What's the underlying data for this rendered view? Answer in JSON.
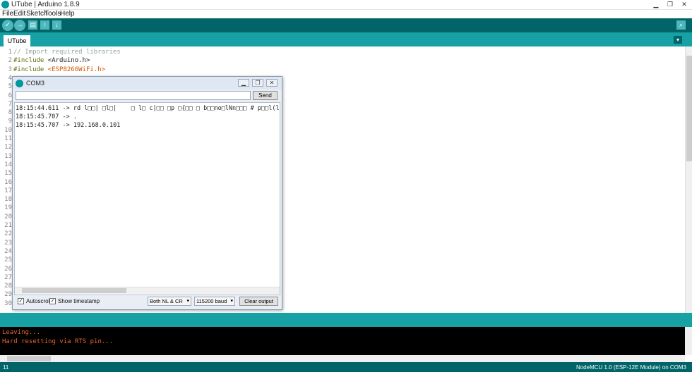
{
  "window": {
    "title": "UTube | Arduino 1.8.9",
    "minimize": "▁",
    "maximize": "❐",
    "close": "✕"
  },
  "menu": [
    "File",
    "Edit",
    "Sketch",
    "Tools",
    "Help"
  ],
  "toolbar": {
    "verify_glyph": "✓",
    "upload_glyph": "→",
    "new_glyph": "▤",
    "open_glyph": "↑",
    "save_glyph": "↓",
    "serial_glyph": "⌕"
  },
  "tab": {
    "label": "UTube",
    "menu_glyph": "▾"
  },
  "editor": {
    "line_numbers": [
      "1",
      "2",
      "3",
      "4",
      "5",
      "6",
      "7",
      "8",
      "9",
      "10",
      "11",
      "12",
      "13",
      "14",
      "15",
      "16",
      "17",
      "18",
      "19",
      "20",
      "21",
      "22",
      "23",
      "24",
      "25",
      "26",
      "27",
      "28",
      "29",
      "30"
    ],
    "line1": "// Import required libraries",
    "line2_kw": "#include",
    "line2_inc": "<Arduino.h>",
    "line3_kw": "#include",
    "line3_inc": "<ESP8266WiFi.h>"
  },
  "console": {
    "lines": [
      "Leaving...",
      "Hard resetting via RTS pin..."
    ]
  },
  "status": {
    "line": "11",
    "board": "NodeMCU 1.0 (ESP-12E Module) on COM3"
  },
  "serial": {
    "title": "COM3",
    "send_label": "Send",
    "input_value": "",
    "output": [
      "18:15:44.611 -> rd l□□| □l□|    □ l□ c|□□ □p □{□□ □ b□□no□lNn□□□ # p□□l(ls$p□o",
      "18:15:45.707 -> .",
      "18:15:45.707 -> 192.168.0.101"
    ],
    "autoscroll": {
      "label": "Autoscroll",
      "checked": true,
      "mark": "✓"
    },
    "timestamp": {
      "label": "Show timestamp",
      "checked": true,
      "mark": "✓"
    },
    "line_ending": "Both NL & CR",
    "baud": "115200 baud",
    "clear_label": "Clear output",
    "dropdown_glyph": "▾"
  },
  "colors": {
    "toolbar": "#006468",
    "tabbar": "#17a1a5",
    "console_text": "#e8662b",
    "console_bg": "#000000"
  }
}
